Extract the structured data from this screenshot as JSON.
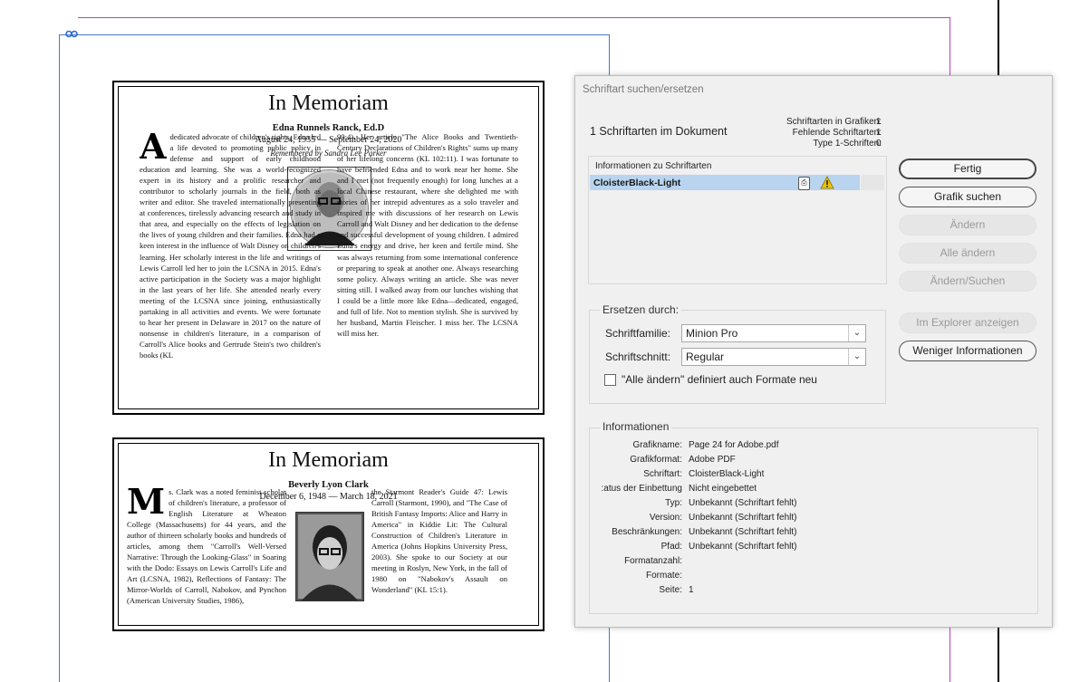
{
  "memorial_1": {
    "title": "In Memoriam",
    "name": "Edna Runnels Ranck, Ed.D",
    "dates": "August 24, 1935 — September 24, 2020",
    "credit": "Remembered by Sandra Lee Parker",
    "dropcap": "A",
    "col1": "dedicated advocate of children's rights, Edna led a life devoted to promoting public policy in defense and support of early childhood education and learning. She was a world-recognized expert in its history and a prolific researcher and contributor to scholarly journals in the field, both as writer and editor. She traveled internationally presenting at conferences, tirelessly advancing research and study in that area, and especially on the effects of legislation on the lives of young children and their families. Edna had a keen interest in the influence of Walt Disney on children's learning. Her scholarly interest in the life and writings of Lewis Carroll led her to join the LCSNA in 2015. Edna's active participation in the Society was a major highlight in the last years of her life. She attended nearly every meeting of the LCSNA since joining, enthusiastically partaking in all activities and events. We were fortunate to hear her present in Delaware in 2017 on the nature of nonsense in children's literature, in a comparison of Carroll's Alice books and Gertrude Stein's two children's books (KL",
    "col2": "99:4). Her article \"The Alice Books and Twentieth-Century Declarations of Children's Rights\" sums up many of her lifelong concerns (KL 102:11). I was fortunate to have befriended Edna and to work near her home. She and I met (not frequently enough) for long lunches at a local Chinese restaurant, where she delighted me with stories of her intrepid adventures as a solo traveler and inspired me with discussions of her research on Lewis Carroll and Walt Disney and her dedication to the defense and successful development of young children. I admired Edna's energy and drive, her keen and fertile mind. She was always returning from some international conference or preparing to speak at another one. Always researching some policy. Always writing an article. She was never sitting still. I walked away from our lunches wishing that I could be a little more like Edna—dedicated, engaged, and full of life. Not to mention stylish. She is survived by her husband, Martin Fleischer. I miss her. The LCSNA will miss her."
  },
  "memorial_2": {
    "title": "In Memoriam",
    "name": "Beverly Lyon Clark",
    "dates": "December 6, 1948 — March 18, 2021",
    "dropcap": "M",
    "col1": "s. Clark was a noted feminist scholar of children's literature, a professor of English Literature at Wheaton College (Massachusetts) for 44 years, and the author of thirteen scholarly books and hundreds of articles, among them \"Carroll's Well-Versed Narrative: Through the Looking-Glass\" in Soaring with the Dodo: Essays on Lewis Carroll's Life and Art (LCSNA, 1982), Reflections of Fantasy: The Mirror-Worlds of Carroll, Nabokov, and Pynchon (American University Studies, 1986),",
    "col2": "the Starmont Reader's Guide 47: Lewis Carroll (Starmont, 1990), and \"The Case of British Fantasy Imports: Alice and Harry in America\" in Kiddie Lit: The Cultural Construction of Children's Literature in America (Johns Hopkins University Press, 2003). She spoke to our Society at our meeting in Roslyn, New York, in the fall of 1980 on \"Nabokov's Assault on Wonderland\" (KL 15:1)."
  },
  "dialog": {
    "title": "Schriftart suchen/ersetzen",
    "fonts_in_document": "1 Schriftarten im Dokument",
    "stats": [
      {
        "label": "Schriftarten in Grafiken:",
        "value": "1"
      },
      {
        "label": "Fehlende Schriftarten:",
        "value": "1"
      },
      {
        "label": "Type 1-Schriften:",
        "value": "0"
      }
    ],
    "font_info_header": "Informationen zu Schriftarten",
    "font_row": {
      "name": "CloisterBlack-Light",
      "icon": "document-icon",
      "status_icon": "warning-icon"
    },
    "buttons": {
      "done": "Fertig",
      "find_graphic": "Grafik suchen",
      "change": "Ändern",
      "change_all": "Alle ändern",
      "change_find": "Ändern/Suchen",
      "reveal_explorer": "Im Explorer anzeigen",
      "less_info": "Weniger Informationen"
    },
    "replace": {
      "section_label": "Ersetzen durch:",
      "family_label": "Schriftfamilie:",
      "family_value": "Minion Pro",
      "style_label": "Schriftschnitt:",
      "style_value": "Regular",
      "checkbox_label": "\"Alle ändern\" definiert auch Formate neu",
      "checkbox_checked": false
    },
    "info": {
      "section_label": "Informationen",
      "rows": [
        {
          "key": "Grafikname:",
          "value": "Page 24 for Adobe.pdf"
        },
        {
          "key": "Grafikformat:",
          "value": "Adobe PDF"
        },
        {
          "key": "Schriftart:",
          "value": "CloisterBlack-Light"
        },
        {
          "key": "atus der Einbettung:",
          "value": "Nicht eingebettet"
        },
        {
          "key": "Typ:",
          "value": "Unbekannt (Schriftart fehlt)"
        },
        {
          "key": "Version:",
          "value": "Unbekannt (Schriftart fehlt)"
        },
        {
          "key": "Beschränkungen:",
          "value": "Unbekannt (Schriftart fehlt)"
        },
        {
          "key": "Pfad:",
          "value": "Unbekannt (Schriftart fehlt)"
        },
        {
          "key": "Formatanzahl:",
          "value": ""
        },
        {
          "key": "Formate:",
          "value": ""
        },
        {
          "key": "Seite:",
          "value": "1"
        }
      ]
    }
  },
  "colors": {
    "guide": "#c43cc4",
    "frame": "#4a78c8",
    "selection": "#b8d4ef",
    "warning": "#f2c200"
  }
}
